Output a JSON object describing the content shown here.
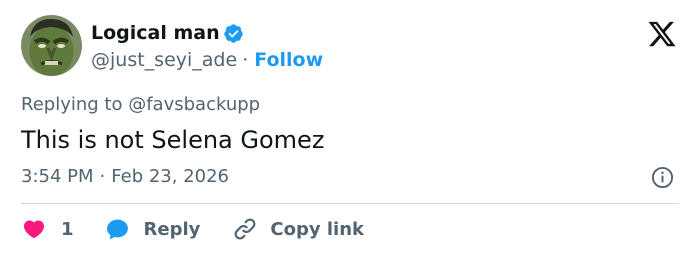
{
  "author": {
    "display_name": "Logical man",
    "handle": "@just_seyi_ade",
    "separator": "·",
    "follow_label": "Follow",
    "verified_color": "#1d9bf0",
    "avatar_icon": "hulk-face-avatar"
  },
  "reply_context": {
    "prefix": "Replying to",
    "mention": "@favsbackupp"
  },
  "tweet": {
    "text": "This is not Selena Gomez",
    "time": "3:54 PM",
    "separator": "·",
    "date": "Feb 23, 2026"
  },
  "actions": {
    "like_count": "1",
    "like_color": "#f91880",
    "reply_label": "Reply",
    "reply_color": "#1d9bf0",
    "copy_link_label": "Copy link"
  },
  "icons": {
    "brand": "x-logo-icon",
    "info": "info-icon",
    "like": "heart-icon",
    "reply": "speech-bubble-icon",
    "copy": "link-icon"
  }
}
